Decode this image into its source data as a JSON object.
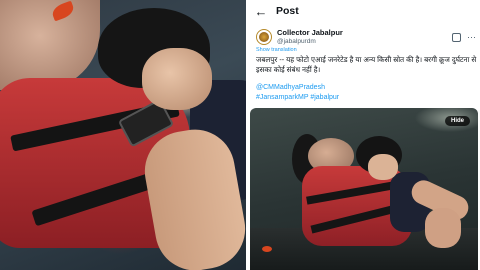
{
  "post": {
    "header_title": "Post",
    "author_name": "Collector Jabalpur",
    "author_handle": "@jabalpurdm",
    "show_translation": "Show translation",
    "body": "जबलपुर -- यह फोटो एआई जनरेटेड है या अन्य किसी स्रोत की है। बरगी क्रूज दुर्घटना से इसका कोई संबंध नहीं है।",
    "mention": "@CMMadhyaPradesh",
    "hashtags": "#JansamparkMP #jabalpur",
    "photo_button": "Hide"
  },
  "icons": {
    "back": "back-arrow-icon",
    "more": "more-icon",
    "grok": "grok-icon"
  },
  "colors": {
    "link": "#1d9bf0",
    "text": "#0f1419",
    "muted": "#536471"
  }
}
